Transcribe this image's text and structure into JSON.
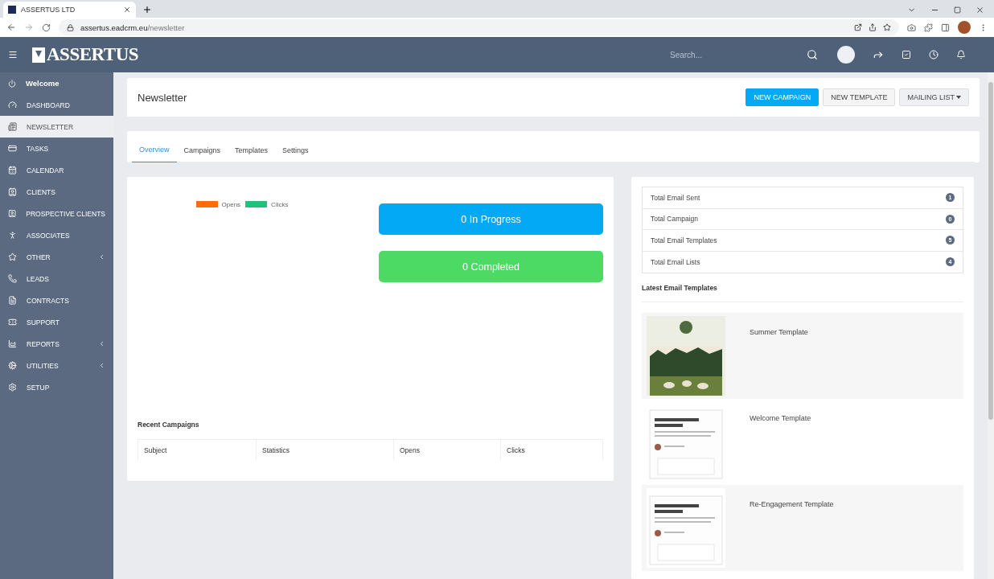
{
  "browser": {
    "tab_title": "ASSERTUS LTD",
    "url_host": "assertus.eadcrm.eu",
    "url_path": "/newsletter"
  },
  "header": {
    "logo": "ASSERTUS",
    "search": {
      "placeholder": "Search..."
    }
  },
  "sidebar": {
    "welcome": "Welcome",
    "items": [
      {
        "label": "DASHBOARD",
        "selected": false,
        "submenu": false
      },
      {
        "label": "NEWSLETTER",
        "selected": true,
        "submenu": false
      },
      {
        "label": "TASKS",
        "selected": false,
        "submenu": false
      },
      {
        "label": "CALENDAR",
        "selected": false,
        "submenu": false
      },
      {
        "label": "CLIENTS",
        "selected": false,
        "submenu": false
      },
      {
        "label": "PROSPECTIVE CLIENTS",
        "selected": false,
        "submenu": false
      },
      {
        "label": "ASSOCIATES",
        "selected": false,
        "submenu": false
      },
      {
        "label": "OTHER",
        "selected": false,
        "submenu": true
      },
      {
        "label": "LEADS",
        "selected": false,
        "submenu": false
      },
      {
        "label": "CONTRACTS",
        "selected": false,
        "submenu": false
      },
      {
        "label": "SUPPORT",
        "selected": false,
        "submenu": false
      },
      {
        "label": "REPORTS",
        "selected": false,
        "submenu": true
      },
      {
        "label": "UTILITIES",
        "selected": false,
        "submenu": true
      },
      {
        "label": "SETUP",
        "selected": false,
        "submenu": false
      }
    ]
  },
  "page": {
    "title": "Newsletter",
    "actions": [
      {
        "label": "NEW CAMPAIGN",
        "kind": "primary"
      },
      {
        "label": "NEW TEMPLATE",
        "kind": "default"
      },
      {
        "label": "MAILING LIST",
        "kind": "dropdown"
      }
    ]
  },
  "tabs": [
    {
      "label": "Overview",
      "selected": true
    },
    {
      "label": "Campaigns",
      "selected": false
    },
    {
      "label": "Templates",
      "selected": false
    },
    {
      "label": "Settings",
      "selected": false
    }
  ],
  "chart_legend": [
    {
      "label": "Opens",
      "color": "#ff6d0a"
    },
    {
      "label": "Clicks",
      "color": "#1fc17b"
    }
  ],
  "status_tiles": [
    {
      "label": "0 In Progress",
      "color": "#03a9f4"
    },
    {
      "label": "0 Completed",
      "color": "#4cd964"
    }
  ],
  "recent_campaigns": {
    "title": "Recent Campaigns",
    "columns": [
      "Subject",
      "Statistics",
      "Opens",
      "Clicks"
    ]
  },
  "totals": [
    {
      "label": "Total Email Sent",
      "count": "1"
    },
    {
      "label": "Total Campaign",
      "count": "0"
    },
    {
      "label": "Total Email Templates",
      "count": "5"
    },
    {
      "label": "Total Email Lists",
      "count": "4"
    }
  ],
  "latest_templates": {
    "title": "Latest Email Templates",
    "items": [
      {
        "name": "Summer Template"
      },
      {
        "name": "Welcome Template",
        "kind": "document"
      },
      {
        "name": "Re-Engagement Template",
        "kind": "document"
      }
    ]
  }
}
